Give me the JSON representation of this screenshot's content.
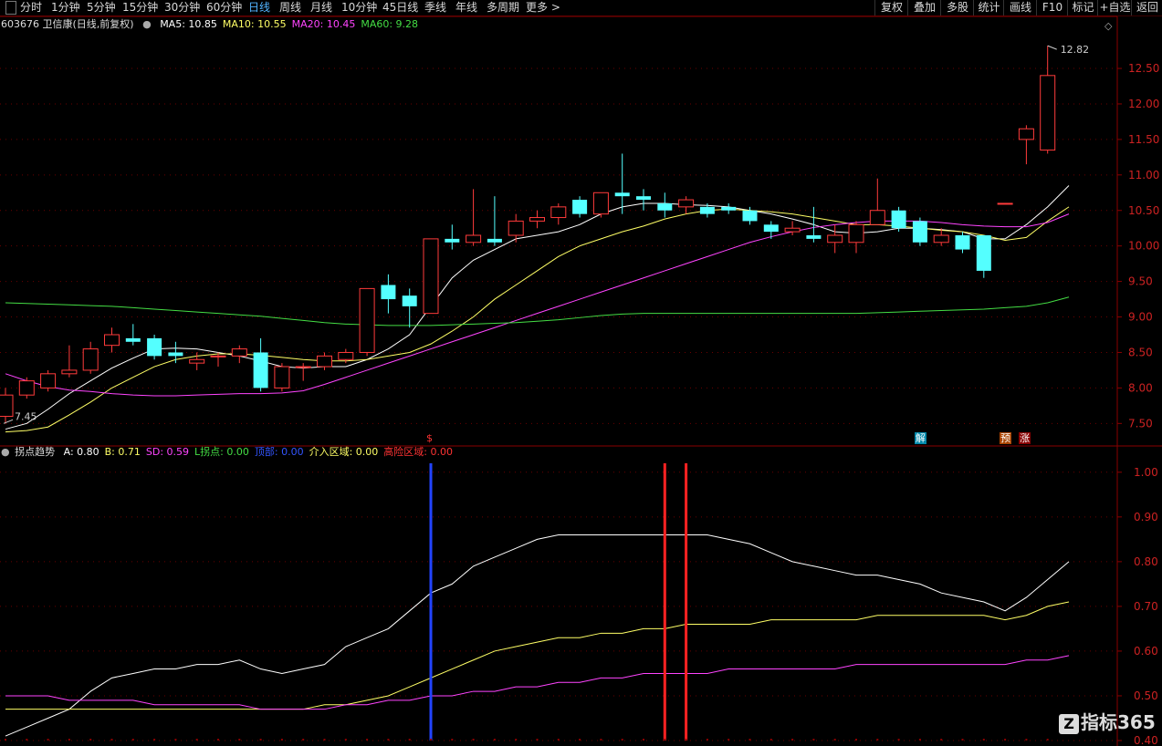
{
  "toolbar": {
    "left_icon": "sidebar-toggle-icon",
    "periods": [
      "分时",
      "1分钟",
      "5分钟",
      "15分钟",
      "30分钟",
      "60分钟",
      "日线",
      "周线",
      "月线",
      "10分钟",
      "45日线",
      "季线",
      "年线",
      "多周期",
      "更多 >"
    ],
    "active_period": "日线",
    "right_buttons": [
      "复权",
      "叠加",
      "多股",
      "统计",
      "画线",
      "F10",
      "标记",
      "+自选",
      "返回"
    ]
  },
  "main_panel": {
    "title": "603676 卫信康(日线,前复权)",
    "ma_labels": [
      {
        "label": "MA5: 10.85",
        "color": "#ffffff"
      },
      {
        "label": "MA10: 10.55",
        "color": "#ffff66"
      },
      {
        "label": "MA20: 10.45",
        "color": "#ff44ff"
      },
      {
        "label": "MA60: 9.28",
        "color": "#44dd44"
      }
    ],
    "high_label": "12.82",
    "low_label": "7.45",
    "corner_icon": "diamond-icon"
  },
  "sub_panel": {
    "title": "拐点趋势",
    "labels": [
      {
        "label": "A: 0.80",
        "color": "#ffffff"
      },
      {
        "label": "B: 0.71",
        "color": "#ffff66"
      },
      {
        "label": "SD: 0.59",
        "color": "#ff44ff"
      },
      {
        "label": "L拐点: 0.00",
        "color": "#44dd44"
      },
      {
        "label": "顶部: 0.00",
        "color": "#3355ff"
      },
      {
        "label": "介入区域: 0.00",
        "color": "#ffff66"
      },
      {
        "label": "高险区域: 0.00",
        "color": "#ff3333"
      }
    ]
  },
  "markers": [
    {
      "text": "$",
      "color": "#ff3333",
      "bg": "transparent"
    },
    {
      "text": "解",
      "color": "#ffffff",
      "bg": "#0088aa"
    },
    {
      "text": "预",
      "color": "#ffffff",
      "bg": "#aa4400"
    },
    {
      "text": "涨",
      "color": "#ffffff",
      "bg": "#880000"
    }
  ],
  "watermark": "指标365",
  "chart_data": [
    {
      "type": "candlestick",
      "title": "603676 卫信康(日线,前复权)",
      "y_ticks": [
        7.5,
        8.0,
        8.5,
        9.0,
        9.5,
        10.0,
        10.5,
        11.0,
        11.5,
        12.0,
        12.5
      ],
      "ylim": [
        7.35,
        12.95
      ],
      "candles": [
        [
          7.6,
          7.9,
          8.0,
          7.5
        ],
        [
          7.9,
          8.1,
          8.15,
          7.85
        ],
        [
          8.0,
          8.2,
          8.25,
          7.95
        ],
        [
          8.2,
          8.25,
          8.6,
          8.15
        ],
        [
          8.25,
          8.55,
          8.65,
          8.2
        ],
        [
          8.6,
          8.75,
          8.85,
          8.5
        ],
        [
          8.7,
          8.65,
          8.9,
          8.6
        ],
        [
          8.7,
          8.45,
          8.75,
          8.4
        ],
        [
          8.5,
          8.45,
          8.65,
          8.35
        ],
        [
          8.35,
          8.4,
          8.5,
          8.25
        ],
        [
          8.45,
          8.45,
          8.5,
          8.3
        ],
        [
          8.45,
          8.55,
          8.6,
          8.35
        ],
        [
          8.5,
          8.0,
          8.7,
          7.95
        ],
        [
          8.0,
          8.3,
          8.35,
          7.95
        ],
        [
          8.3,
          8.3,
          8.35,
          8.1
        ],
        [
          8.3,
          8.45,
          8.5,
          8.25
        ],
        [
          8.4,
          8.5,
          8.55,
          8.35
        ],
        [
          8.5,
          9.4,
          9.4,
          8.45
        ],
        [
          9.45,
          9.25,
          9.6,
          9.05
        ],
        [
          9.3,
          9.15,
          9.4,
          8.85
        ],
        [
          9.05,
          10.1,
          10.1,
          9.05
        ],
        [
          10.1,
          10.05,
          10.3,
          9.95
        ],
        [
          10.05,
          10.15,
          10.8,
          10.0
        ],
        [
          10.1,
          10.05,
          10.7,
          10.0
        ],
        [
          10.15,
          10.35,
          10.45,
          10.05
        ],
        [
          10.35,
          10.4,
          10.5,
          10.25
        ],
        [
          10.4,
          10.55,
          10.6,
          10.3
        ],
        [
          10.65,
          10.45,
          10.7,
          10.4
        ],
        [
          10.45,
          10.75,
          10.75,
          10.4
        ],
        [
          10.75,
          10.7,
          11.3,
          10.45
        ],
        [
          10.7,
          10.65,
          10.8,
          10.5
        ],
        [
          10.6,
          10.5,
          10.75,
          10.4
        ],
        [
          10.55,
          10.65,
          10.7,
          10.45
        ],
        [
          10.55,
          10.45,
          10.6,
          10.4
        ],
        [
          10.55,
          10.5,
          10.6,
          10.45
        ],
        [
          10.5,
          10.35,
          10.55,
          10.3
        ],
        [
          10.3,
          10.2,
          10.35,
          10.1
        ],
        [
          10.2,
          10.25,
          10.35,
          10.15
        ],
        [
          10.15,
          10.1,
          10.55,
          10.05
        ],
        [
          10.05,
          10.15,
          10.3,
          9.9
        ],
        [
          10.05,
          10.3,
          10.35,
          9.9
        ],
        [
          10.3,
          10.5,
          10.95,
          10.3
        ],
        [
          10.5,
          10.25,
          10.55,
          10.2
        ],
        [
          10.35,
          10.05,
          10.4,
          10.0
        ],
        [
          10.05,
          10.15,
          10.25,
          10.0
        ],
        [
          10.15,
          9.95,
          10.2,
          9.9
        ],
        [
          10.15,
          9.65,
          10.15,
          9.55
        ],
        [
          10.6,
          10.6,
          10.6,
          10.6
        ],
        [
          11.5,
          11.65,
          11.7,
          11.15
        ],
        [
          11.35,
          12.4,
          12.82,
          11.3
        ]
      ],
      "ma": {
        "MA5": [
          7.42,
          7.5,
          7.7,
          7.92,
          8.1,
          8.28,
          8.42,
          8.55,
          8.56,
          8.55,
          8.5,
          8.45,
          8.38,
          8.3,
          8.28,
          8.3,
          8.3,
          8.4,
          8.55,
          8.75,
          9.15,
          9.55,
          9.8,
          9.95,
          10.1,
          10.15,
          10.2,
          10.3,
          10.45,
          10.55,
          10.6,
          10.6,
          10.58,
          10.57,
          10.55,
          10.5,
          10.45,
          10.38,
          10.3,
          10.2,
          10.18,
          10.2,
          10.25,
          10.25,
          10.23,
          10.2,
          10.1,
          10.1,
          10.3,
          10.55,
          10.85
        ],
        "MA10": [
          7.38,
          7.4,
          7.45,
          7.62,
          7.8,
          8.0,
          8.15,
          8.3,
          8.4,
          8.45,
          8.48,
          8.48,
          8.46,
          8.43,
          8.4,
          8.38,
          8.38,
          8.4,
          8.45,
          8.5,
          8.62,
          8.8,
          9.0,
          9.25,
          9.45,
          9.65,
          9.85,
          10.0,
          10.1,
          10.2,
          10.28,
          10.38,
          10.45,
          10.5,
          10.52,
          10.5,
          10.48,
          10.45,
          10.4,
          10.35,
          10.3,
          10.3,
          10.28,
          10.25,
          10.22,
          10.2,
          10.15,
          10.08,
          10.12,
          10.35,
          10.55
        ],
        "MA20": [
          8.2,
          8.1,
          8.02,
          7.97,
          7.95,
          7.92,
          7.9,
          7.89,
          7.89,
          7.9,
          7.91,
          7.92,
          7.92,
          7.93,
          7.96,
          8.05,
          8.15,
          8.25,
          8.35,
          8.45,
          8.55,
          8.65,
          8.75,
          8.85,
          8.95,
          9.05,
          9.15,
          9.25,
          9.35,
          9.45,
          9.55,
          9.65,
          9.75,
          9.85,
          9.95,
          10.05,
          10.13,
          10.2,
          10.26,
          10.3,
          10.33,
          10.35,
          10.35,
          10.35,
          10.33,
          10.3,
          10.28,
          10.27,
          10.27,
          10.33,
          10.45
        ],
        "MA60": [
          9.2,
          9.19,
          9.18,
          9.17,
          9.16,
          9.15,
          9.13,
          9.11,
          9.09,
          9.07,
          9.05,
          9.03,
          9.01,
          8.98,
          8.95,
          8.92,
          8.9,
          8.89,
          8.88,
          8.88,
          8.88,
          8.89,
          8.9,
          8.91,
          8.92,
          8.94,
          8.96,
          8.99,
          9.02,
          9.04,
          9.05,
          9.05,
          9.05,
          9.05,
          9.05,
          9.05,
          9.05,
          9.05,
          9.05,
          9.05,
          9.05,
          9.06,
          9.07,
          9.08,
          9.09,
          9.1,
          9.11,
          9.13,
          9.15,
          9.2,
          9.28
        ]
      }
    },
    {
      "type": "line",
      "title": "拐点趋势",
      "y_ticks": [
        0.4,
        0.5,
        0.6,
        0.7,
        0.8,
        0.9,
        1.0
      ],
      "ylim": [
        0.4,
        1.02
      ],
      "series": [
        {
          "name": "A",
          "color": "#ffffff",
          "values": [
            0.41,
            0.43,
            0.45,
            0.47,
            0.51,
            0.54,
            0.55,
            0.56,
            0.56,
            0.57,
            0.57,
            0.58,
            0.56,
            0.55,
            0.56,
            0.57,
            0.61,
            0.63,
            0.65,
            0.69,
            0.73,
            0.75,
            0.79,
            0.81,
            0.83,
            0.85,
            0.86,
            0.86,
            0.86,
            0.86,
            0.86,
            0.86,
            0.86,
            0.86,
            0.85,
            0.84,
            0.82,
            0.8,
            0.79,
            0.78,
            0.77,
            0.77,
            0.76,
            0.75,
            0.73,
            0.72,
            0.71,
            0.69,
            0.72,
            0.76,
            0.8
          ]
        },
        {
          "name": "B",
          "color": "#ffff66",
          "values": [
            0.47,
            0.47,
            0.47,
            0.47,
            0.47,
            0.47,
            0.47,
            0.47,
            0.47,
            0.47,
            0.47,
            0.47,
            0.47,
            0.47,
            0.47,
            0.48,
            0.48,
            0.49,
            0.5,
            0.52,
            0.54,
            0.56,
            0.58,
            0.6,
            0.61,
            0.62,
            0.63,
            0.63,
            0.64,
            0.64,
            0.65,
            0.65,
            0.66,
            0.66,
            0.66,
            0.66,
            0.67,
            0.67,
            0.67,
            0.67,
            0.67,
            0.68,
            0.68,
            0.68,
            0.68,
            0.68,
            0.68,
            0.67,
            0.68,
            0.7,
            0.71
          ]
        },
        {
          "name": "SD",
          "color": "#ff44ff",
          "values": [
            0.5,
            0.5,
            0.5,
            0.49,
            0.49,
            0.49,
            0.49,
            0.48,
            0.48,
            0.48,
            0.48,
            0.48,
            0.47,
            0.47,
            0.47,
            0.47,
            0.48,
            0.48,
            0.49,
            0.49,
            0.5,
            0.5,
            0.51,
            0.51,
            0.52,
            0.52,
            0.53,
            0.53,
            0.54,
            0.54,
            0.55,
            0.55,
            0.55,
            0.55,
            0.56,
            0.56,
            0.56,
            0.56,
            0.56,
            0.56,
            0.57,
            0.57,
            0.57,
            0.57,
            0.57,
            0.57,
            0.57,
            0.57,
            0.58,
            0.58,
            0.59
          ]
        }
      ],
      "signals": [
        {
          "index": 20,
          "color": "#2244ff"
        },
        {
          "index": 31,
          "color": "#ff2222"
        },
        {
          "index": 32,
          "color": "#ff2222"
        }
      ]
    }
  ]
}
